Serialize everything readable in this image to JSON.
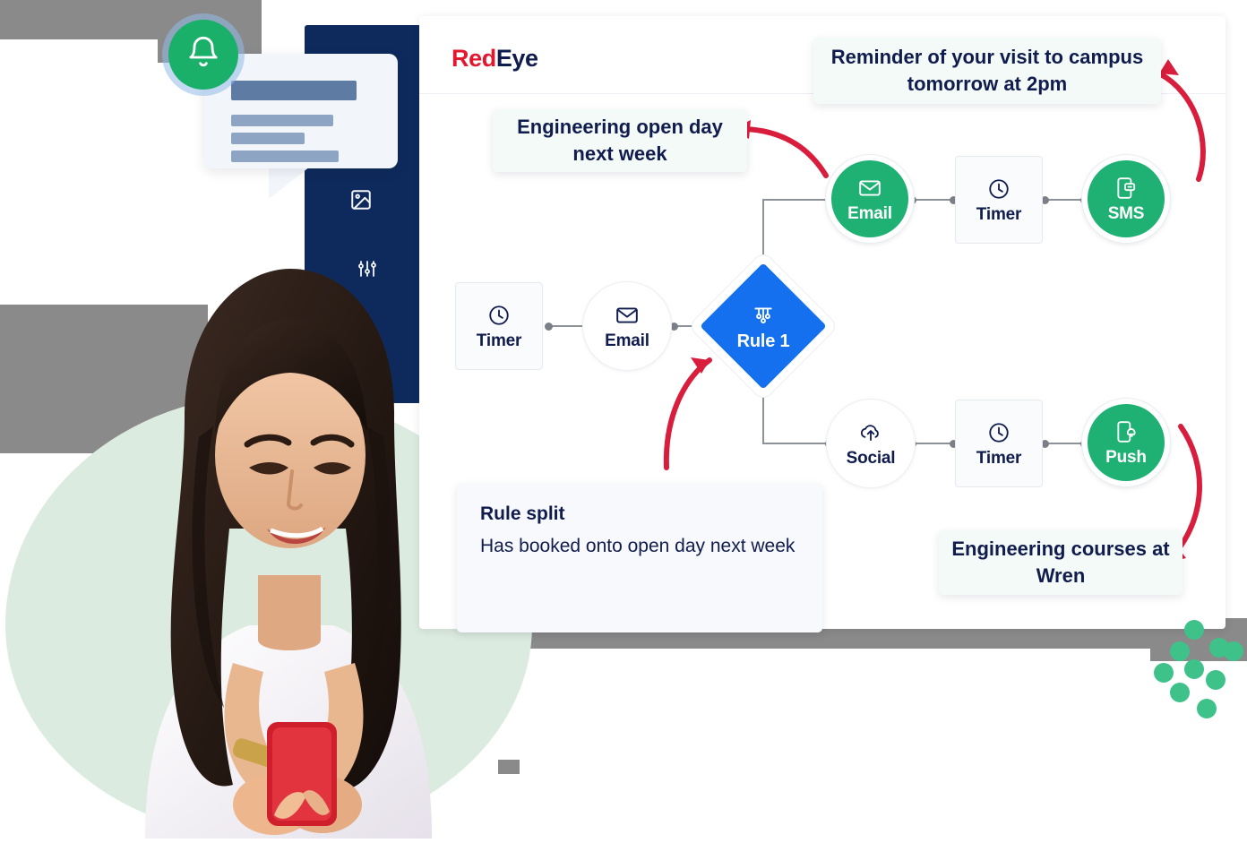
{
  "app": {
    "logo_red": "Red",
    "logo_navy": "Eye"
  },
  "sidebar": {
    "icons": [
      {
        "name": "image-icon",
        "label": "Image"
      },
      {
        "name": "sliders-icon",
        "label": "Settings"
      }
    ]
  },
  "notification": {
    "bell_icon": "bell-icon",
    "placeholder_lines": 4
  },
  "flow": {
    "nodes": [
      {
        "id": "timer-1",
        "label": "Timer",
        "icon": "clock-icon",
        "shape": "square",
        "style": "white"
      },
      {
        "id": "email-1",
        "label": "Email",
        "icon": "envelope-icon",
        "shape": "circle",
        "style": "white"
      },
      {
        "id": "rule-1",
        "label": "Rule 1",
        "icon": "rule-split-icon",
        "shape": "diamond",
        "style": "blue"
      },
      {
        "id": "email-2",
        "label": "Email",
        "icon": "envelope-icon",
        "shape": "circle",
        "style": "green"
      },
      {
        "id": "timer-2",
        "label": "Timer",
        "icon": "clock-icon",
        "shape": "square",
        "style": "white"
      },
      {
        "id": "sms-1",
        "label": "SMS",
        "icon": "sms-phone-icon",
        "shape": "circle",
        "style": "green"
      },
      {
        "id": "social-1",
        "label": "Social",
        "icon": "cloud-upload-icon",
        "shape": "circle",
        "style": "white"
      },
      {
        "id": "timer-3",
        "label": "Timer",
        "icon": "clock-icon",
        "shape": "square",
        "style": "white"
      },
      {
        "id": "push-1",
        "label": "Push",
        "icon": "push-bell-icon",
        "shape": "circle",
        "style": "green"
      }
    ]
  },
  "callouts": {
    "reminder": "Reminder of your visit to campus tomorrow at 2pm",
    "open_day": "Engineering open day next week",
    "rule_split_title": "Rule split",
    "rule_split_body": "Has booked onto open day next week",
    "courses": "Engineering courses at Wren"
  },
  "colors": {
    "brand_red": "#e2182f",
    "brand_navy": "#101c4e",
    "node_green": "#1eb173",
    "rule_blue": "#1570ef",
    "arrow_red": "#d81e3c",
    "sidebar_navy": "#0e2a5c",
    "blob_green": "#dcebe0"
  }
}
